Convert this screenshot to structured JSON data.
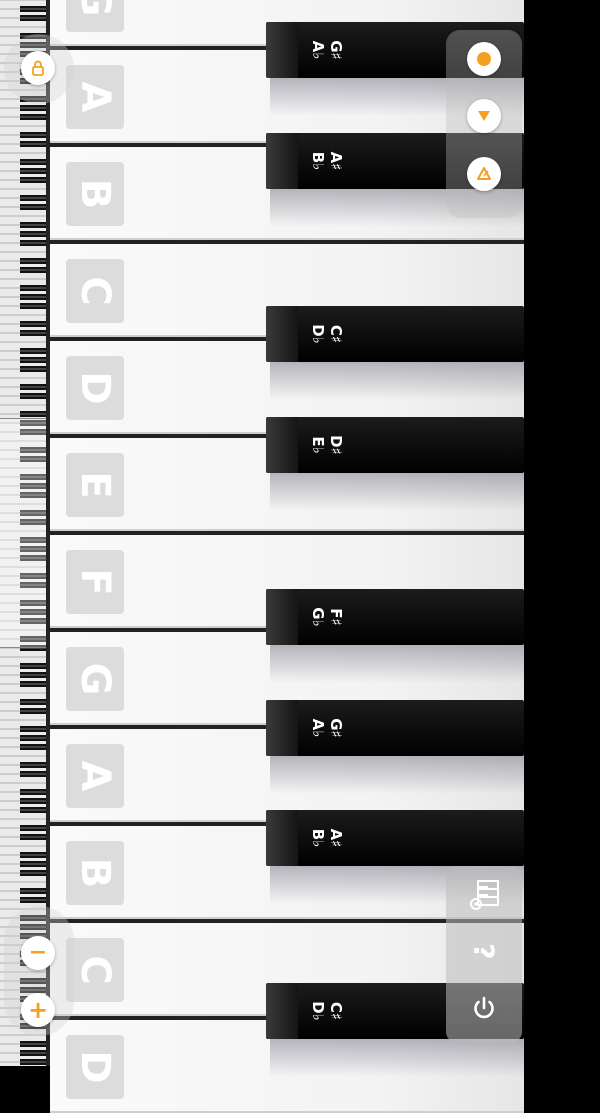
{
  "white_keys": [
    {
      "label": "G"
    },
    {
      "label": "A"
    },
    {
      "label": "B"
    },
    {
      "label": "C"
    },
    {
      "label": "D"
    },
    {
      "label": "E"
    },
    {
      "label": "F"
    },
    {
      "label": "G"
    },
    {
      "label": "A"
    },
    {
      "label": "B"
    },
    {
      "label": "C"
    },
    {
      "label": "D"
    }
  ],
  "black_keys": [
    {
      "sharp": "G♯",
      "flat": "A♭"
    },
    {
      "sharp": "A♯",
      "flat": "B♭"
    },
    {
      "sharp": "C♯",
      "flat": "D♭"
    },
    {
      "sharp": "D♯",
      "flat": "E♭"
    },
    {
      "sharp": "F♯",
      "flat": "G♭"
    },
    {
      "sharp": "G♯",
      "flat": "A♭"
    },
    {
      "sharp": "A♯",
      "flat": "B♭"
    },
    {
      "sharp": "C♯",
      "flat": "D♭"
    }
  ],
  "controls": {
    "record": "record-icon",
    "play": "play-icon",
    "metronome": "metronome-icon",
    "keyboard_settings": "keyboard-settings-icon",
    "help": "?",
    "power": "power-icon",
    "lock": "lock-icon",
    "zoom_out": "−",
    "zoom_in": "+"
  },
  "accent_color": "#f5a020"
}
